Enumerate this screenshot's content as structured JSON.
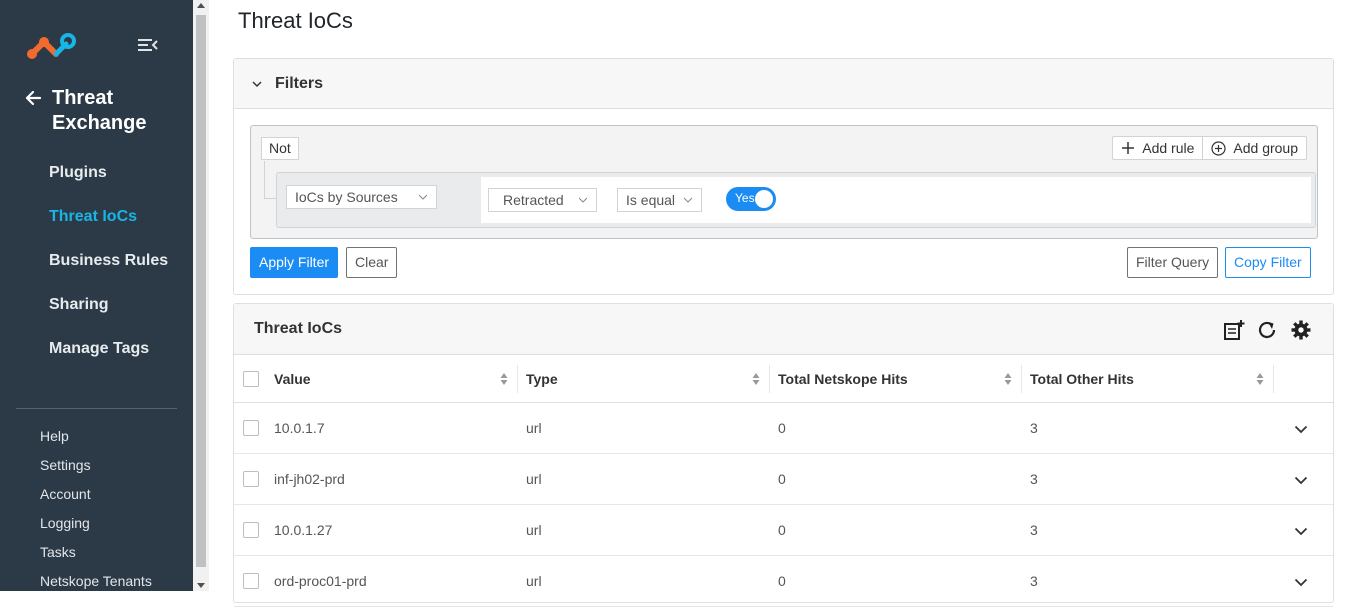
{
  "sidebar": {
    "section_title_line1": "Threat",
    "section_title_line2": "Exchange",
    "nav": [
      {
        "label": "Plugins"
      },
      {
        "label": "Threat IoCs"
      },
      {
        "label": "Business Rules"
      },
      {
        "label": "Sharing"
      },
      {
        "label": "Manage Tags"
      }
    ],
    "active_index": 1,
    "subnav": [
      {
        "label": "Help"
      },
      {
        "label": "Settings"
      },
      {
        "label": "Account"
      },
      {
        "label": "Logging"
      },
      {
        "label": "Tasks"
      },
      {
        "label": "Netskope Tenants"
      }
    ],
    "colors": {
      "background": "#2c3a47",
      "active": "#19b5e6",
      "logo_orange": "#f26a2e",
      "logo_blue": "#19b5e6"
    }
  },
  "page": {
    "title": "Threat IoCs"
  },
  "filters": {
    "title": "Filters",
    "not_label": "Not",
    "add_rule_label": "Add rule",
    "add_group_label": "Add group",
    "rule": {
      "field": "IoCs by Sources",
      "subfield": "Retracted",
      "operator": "Is equal",
      "value_label": "Yes",
      "value_on": true
    },
    "apply_label": "Apply Filter",
    "clear_label": "Clear",
    "filter_query_label": "Filter Query",
    "copy_filter_label": "Copy Filter"
  },
  "table": {
    "title": "Threat IoCs",
    "toolbar_icons": [
      "add-list-icon",
      "refresh-icon",
      "gear-icon"
    ],
    "columns": [
      "Value",
      "Type",
      "Total Netskope Hits",
      "Total Other Hits"
    ],
    "rows": [
      {
        "value": "10.0.1.7",
        "type": "url",
        "netskope_hits": "0",
        "other_hits": "3"
      },
      {
        "value": "inf-jh02-prd",
        "type": "url",
        "netskope_hits": "0",
        "other_hits": "3"
      },
      {
        "value": "10.0.1.27",
        "type": "url",
        "netskope_hits": "0",
        "other_hits": "3"
      },
      {
        "value": "ord-proc01-prd",
        "type": "url",
        "netskope_hits": "0",
        "other_hits": "3"
      }
    ]
  },
  "accent_color": "#1a8cf4"
}
